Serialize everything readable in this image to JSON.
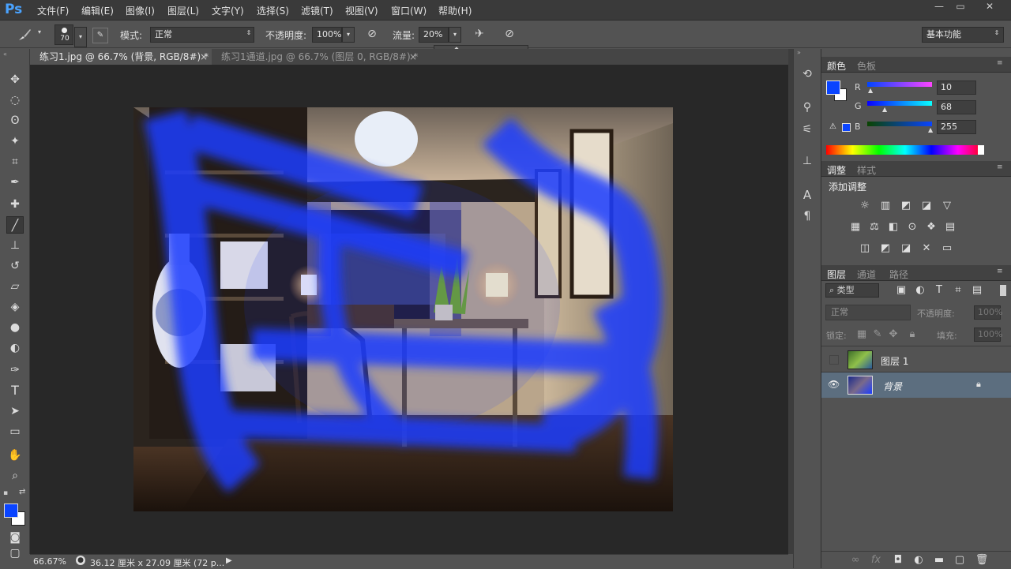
{
  "app": {
    "logo": "Ps"
  },
  "menu": [
    "文件(F)",
    "编辑(E)",
    "图像(I)",
    "图层(L)",
    "文字(Y)",
    "选择(S)",
    "滤镜(T)",
    "视图(V)",
    "窗口(W)",
    "帮助(H)"
  ],
  "window_controls": {
    "minimize": "—",
    "restore": "▭",
    "close": "✕"
  },
  "options": {
    "brush_size": "70",
    "mode_label": "模式:",
    "mode_value": "正常",
    "opacity_label": "不透明度:",
    "opacity_value": "100%",
    "flow_label": "流量:",
    "flow_value": "20%",
    "workspace": "基本功能"
  },
  "tabs": [
    {
      "label": "练习1.jpg @ 66.7% (背景, RGB/8#) *",
      "close": "×"
    },
    {
      "label": "练习1通道.jpg @ 66.7% (图层 0, RGB/8#) *",
      "close": "×"
    }
  ],
  "status": {
    "zoom": "66.67%",
    "doc_size": "36.12 厘米 x 27.09 厘米 (72 p..."
  },
  "color_panel": {
    "tab_active": "颜色",
    "tab_other": "色板",
    "r_label": "R",
    "g_label": "G",
    "b_label": "B",
    "r": "10",
    "g": "68",
    "b": "255",
    "fg_color": "#0a44ff"
  },
  "adjust_panel": {
    "tab_active": "调整",
    "tab_other": "样式",
    "title": "添加调整"
  },
  "layers_panel": {
    "tab_active": "图层",
    "tab_channels": "通道",
    "tab_paths": "路径",
    "filter_kind": "类型",
    "blend_mode": "正常",
    "opacity_label": "不透明度:",
    "opacity_value": "100%",
    "lock_label": "锁定:",
    "fill_label": "填充:",
    "fill_value": "100%",
    "layers": [
      {
        "name": "图层 1",
        "visible": false,
        "selected": false
      },
      {
        "name": "背景",
        "visible": true,
        "selected": true,
        "locked": true
      }
    ]
  }
}
